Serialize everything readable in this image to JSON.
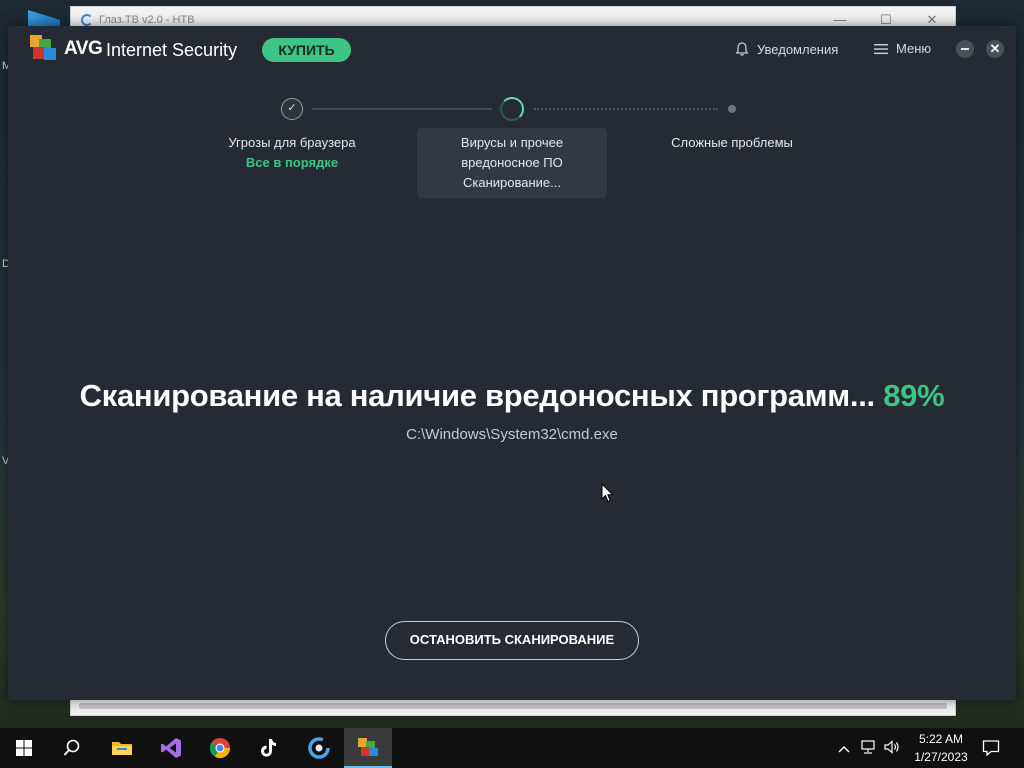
{
  "background_window": {
    "title": "Глаз.ТВ v2.0 - НТВ",
    "controls": {
      "minimize": "—",
      "maximize": "☐",
      "close": "✕"
    }
  },
  "desktop": {
    "edge_letters": [
      "M",
      "D",
      "V"
    ]
  },
  "avg": {
    "brand": "AVG",
    "product": "Internet Security",
    "buy_label": "КУПИТЬ",
    "notifications_label": "Уведомления",
    "menu_label": "Меню",
    "close_glyph": "✕"
  },
  "steps": [
    {
      "title": "Угрозы для браузера",
      "status": "Все в порядке",
      "state": "done"
    },
    {
      "title_line1": "Вирусы и прочее",
      "title_line2": "вредоносное ПО",
      "status": "Сканирование...",
      "state": "active"
    },
    {
      "title": "Сложные проблемы",
      "state": "pending"
    }
  ],
  "scan": {
    "heading": "Сканирование на наличие вредоносных программ...",
    "percent": "89%",
    "current_file": "C:\\Windows\\System32\\cmd.exe",
    "stop_label": "ОСТАНОВИТЬ СКАНИРОВАНИЕ"
  },
  "taskbar": {
    "apps": [
      "start-icon",
      "search-icon",
      "file-explorer-icon",
      "visual-studio-icon",
      "chrome-icon",
      "tiktok-icon",
      "glaz-tv-icon",
      "avg-icon"
    ],
    "active_app": "avg-icon",
    "time": "5:22 AM",
    "date": "1/27/2023"
  },
  "colors": {
    "accent_green": "#3ec484",
    "window_bg": "#252a33",
    "taskbar_bg": "#101010"
  }
}
